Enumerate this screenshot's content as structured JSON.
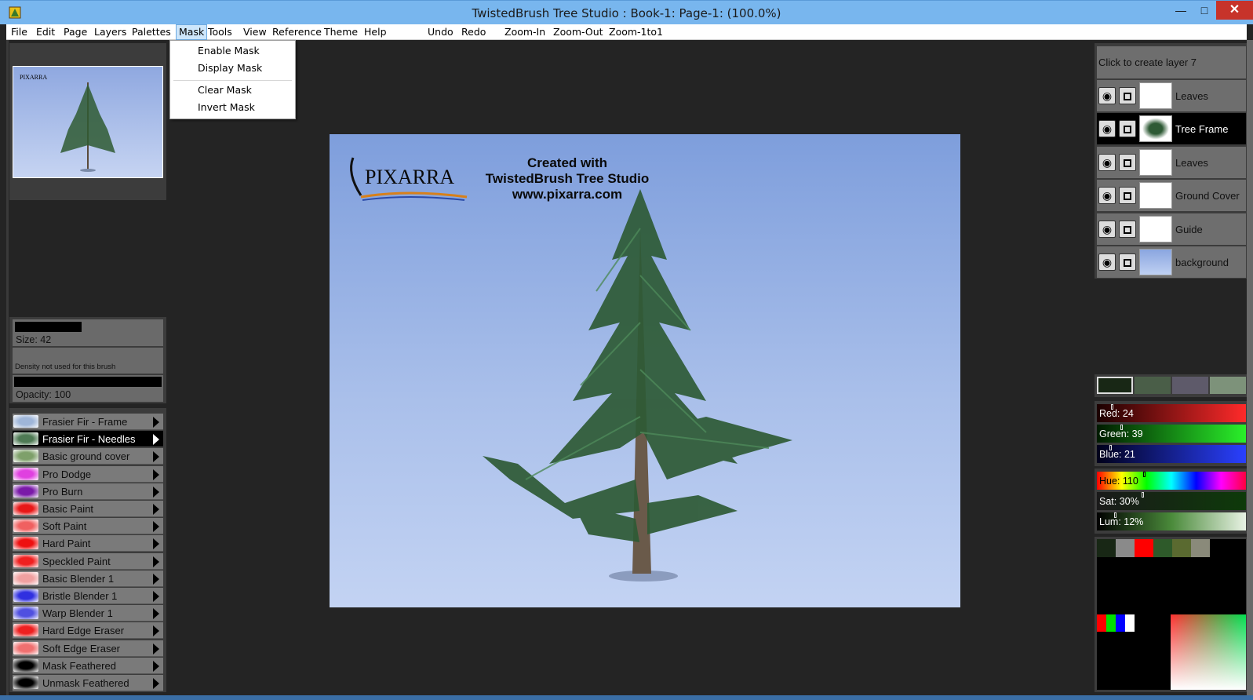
{
  "window": {
    "title": "TwistedBrush Tree Studio : Book-1: Page-1:  (100.0%)"
  },
  "menu": {
    "items": [
      "File",
      "Edit",
      "Page",
      "Layers",
      "Palettes",
      "Mask",
      "Tools",
      "View",
      "Reference",
      "Theme",
      "Help"
    ],
    "toolbar": [
      "Undo",
      "Redo",
      "Zoom-In",
      "Zoom-Out",
      "Zoom-1to1"
    ]
  },
  "mask_menu": {
    "items": [
      "Enable Mask",
      "Display Mask",
      "Clear Mask",
      "Invert Mask"
    ]
  },
  "brush": {
    "size_label": "Size: 42",
    "density_label": "Density not used for this brush",
    "opacity_label": "Opacity: 100",
    "size_value": 42,
    "opacity_value": 100
  },
  "brushes": [
    {
      "label": "Frasier Fir - Frame",
      "icon": "frame-brush-icon",
      "color": "#9fb6d9"
    },
    {
      "label": "Frasier Fir - Needles",
      "icon": "needles-brush-icon",
      "color": "#4e7a54",
      "selected": true
    },
    {
      "label": "Basic ground cover",
      "icon": "ground-brush-icon",
      "color": "#7ea06a"
    },
    {
      "label": "Pro Dodge",
      "icon": "dodge-brush-icon",
      "color": "#e040e0"
    },
    {
      "label": "Pro Burn",
      "icon": "burn-brush-icon",
      "color": "#7a1aa8"
    },
    {
      "label": "Basic Paint",
      "icon": "paint-brush-icon",
      "color": "#e81818"
    },
    {
      "label": "Soft Paint",
      "icon": "soft-paint-icon",
      "color": "#f06060"
    },
    {
      "label": "Hard Paint",
      "icon": "hard-paint-icon",
      "color": "#ee1010"
    },
    {
      "label": "Speckled Paint",
      "icon": "speckled-paint-icon",
      "color": "#f02020"
    },
    {
      "label": "Basic Blender 1",
      "icon": "blender-icon",
      "color": "#f0a0a0"
    },
    {
      "label": "Bristle Blender 1",
      "icon": "bristle-blender-icon",
      "color": "#3030e0"
    },
    {
      "label": "Warp Blender 1",
      "icon": "warp-blender-icon",
      "color": "#5050e0"
    },
    {
      "label": "Hard Edge Eraser",
      "icon": "hard-eraser-icon",
      "color": "#ee2020"
    },
    {
      "label": "Soft Edge Eraser",
      "icon": "soft-eraser-icon",
      "color": "#f07070"
    },
    {
      "label": "Mask Feathered",
      "icon": "mask-feathered-icon",
      "color": "#000000"
    },
    {
      "label": "Unmask Feathered",
      "icon": "unmask-feathered-icon",
      "color": "#000000"
    }
  ],
  "canvas": {
    "logo_text": "PIXARRA",
    "caption_lines": [
      "Created with",
      "TwistedBrush Tree Studio",
      "www.pixarra.com"
    ]
  },
  "layers": {
    "create_label": "Click to create layer 7",
    "items": [
      {
        "name": "Leaves",
        "selected": false
      },
      {
        "name": "Tree Frame",
        "selected": true
      },
      {
        "name": "Leaves",
        "selected": false
      },
      {
        "name": "Ground Cover",
        "selected": false
      },
      {
        "name": "Guide",
        "selected": false
      },
      {
        "name": "background",
        "selected": false
      }
    ]
  },
  "color": {
    "red_label": "Red: 24",
    "green_label": "Green: 39",
    "blue_label": "Blue: 21",
    "hue_label": "Hue: 110",
    "sat_label": "Sat: 30%",
    "lum_label": "Lum: 12%",
    "red": 24,
    "green": 39,
    "blue": 21,
    "hue": 110,
    "sat": 30,
    "lum": 12,
    "current": "#182715",
    "swatches": [
      "#182715",
      "#4a5e48",
      "#5e5a6a",
      "#7d927a"
    ],
    "palette": [
      "#182715",
      "#8a8a8a",
      "#ff0000",
      "#2e5a2a",
      "#5a6a30",
      "#8a8a7a"
    ]
  }
}
